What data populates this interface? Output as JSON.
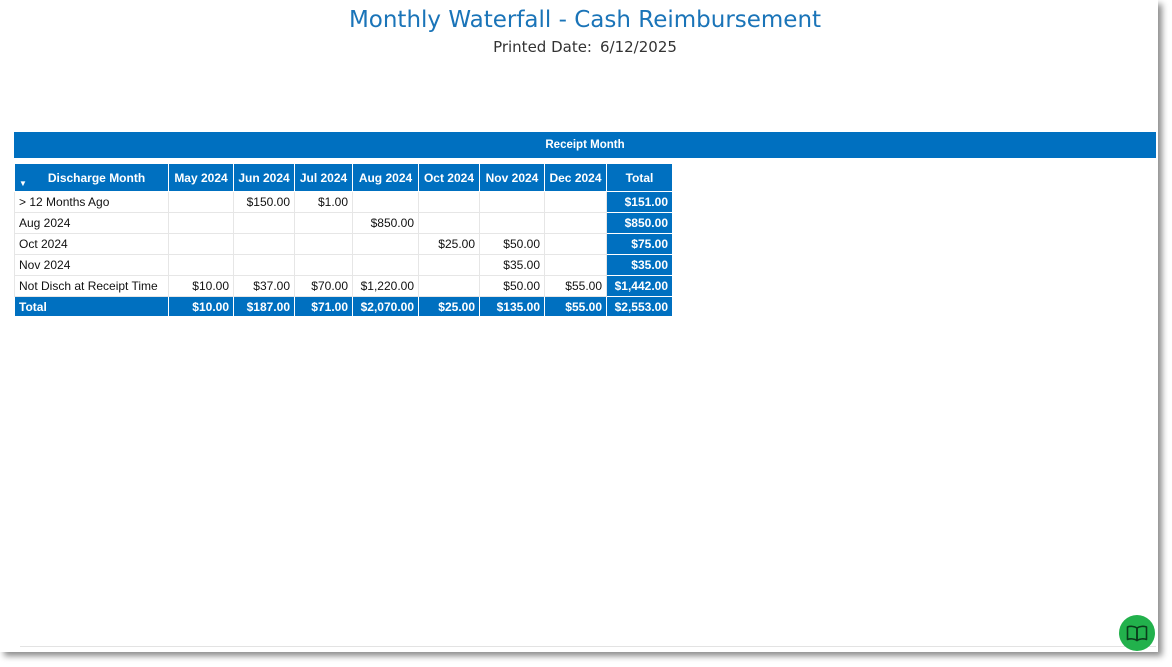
{
  "report": {
    "title": "Monthly Waterfall - Cash Reimbursement",
    "printed_label": "Printed Date:",
    "printed_date": "6/12/2025"
  },
  "table": {
    "group_header": "Receipt Month",
    "row_header": "Discharge Month",
    "columns": [
      "May 2024",
      "Jun 2024",
      "Jul 2024",
      "Aug 2024",
      "Oct 2024",
      "Nov 2024",
      "Dec 2024",
      "Total"
    ],
    "rows": [
      {
        "label": "> 12 Months Ago",
        "cells": [
          "",
          "$150.00",
          "$1.00",
          "",
          "",
          "",
          "",
          "$151.00"
        ]
      },
      {
        "label": "Aug 2024",
        "cells": [
          "",
          "",
          "",
          "$850.00",
          "",
          "",
          "",
          "$850.00"
        ]
      },
      {
        "label": "Oct 2024",
        "cells": [
          "",
          "",
          "",
          "",
          "$25.00",
          "$50.00",
          "",
          "$75.00"
        ]
      },
      {
        "label": "Nov 2024",
        "cells": [
          "",
          "",
          "",
          "",
          "",
          "$35.00",
          "",
          "$35.00"
        ]
      },
      {
        "label": "Not Disch at Receipt Time",
        "cells": [
          "$10.00",
          "$37.00",
          "$70.00",
          "$1,220.00",
          "",
          "$50.00",
          "$55.00",
          "$1,442.00"
        ]
      }
    ],
    "total_row": {
      "label": "Total",
      "cells": [
        "$10.00",
        "$187.00",
        "$71.00",
        "$2,070.00",
        "$25.00",
        "$135.00",
        "$55.00",
        "$2,553.00"
      ]
    }
  },
  "colors": {
    "header_blue": "#0070c0",
    "title_blue": "#1a74b8",
    "help_green": "#22b14c"
  },
  "icons": {
    "sort": "triangle-down-icon",
    "help": "book-icon"
  }
}
